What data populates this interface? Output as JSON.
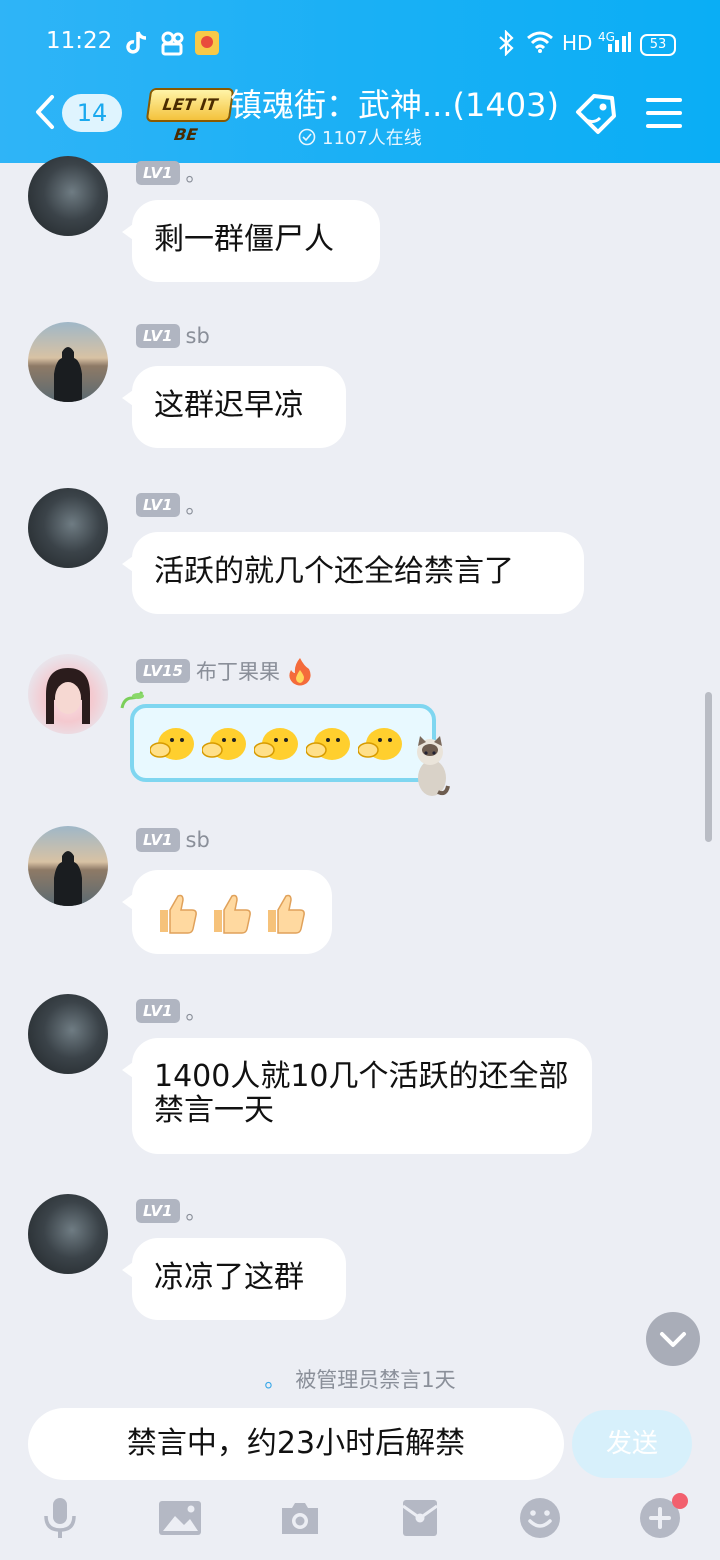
{
  "status_bar": {
    "time": "11:22",
    "network": "HD",
    "signal": "4G",
    "battery": "53"
  },
  "header": {
    "back_count": "14",
    "logo_text": "LET IT BE",
    "title": "镇魂街：武神...(1403)",
    "online": "1107人在线"
  },
  "messages": [
    {
      "level": "LV1",
      "name": "。",
      "text": "剩一群僵尸人"
    },
    {
      "level": "LV1",
      "name": "sb",
      "text": "这群迟早凉"
    },
    {
      "level": "LV1",
      "name": "。",
      "text": "活跃的就几个还全给禁言了"
    },
    {
      "level": "LV15",
      "name": "布丁果果",
      "text": ""
    },
    {
      "level": "LV1",
      "name": "sb",
      "text": ""
    },
    {
      "level": "LV1",
      "name": "。",
      "text": "1400人就10几个活跃的还全部禁言一天"
    },
    {
      "level": "LV1",
      "name": "。",
      "text": "凉凉了这群"
    }
  ],
  "notice": {
    "name": "。",
    "text": "被管理员禁言1天"
  },
  "input": {
    "muted_text": "禁言中，约23小时后解禁",
    "send_label": "发送"
  },
  "colors": {
    "header": "#1ab0f5",
    "background": "#eceef4",
    "badge": "#b0b5c1",
    "notification_dot": "#f2606e"
  },
  "icons": [
    "back-icon",
    "tag-icon",
    "menu-icon",
    "fire-icon",
    "thumbs-up-icon",
    "duck-emoji-icon",
    "scroll-down-icon",
    "microphone-icon",
    "image-icon",
    "camera-icon",
    "red-packet-icon",
    "emoji-icon",
    "plus-icon"
  ]
}
